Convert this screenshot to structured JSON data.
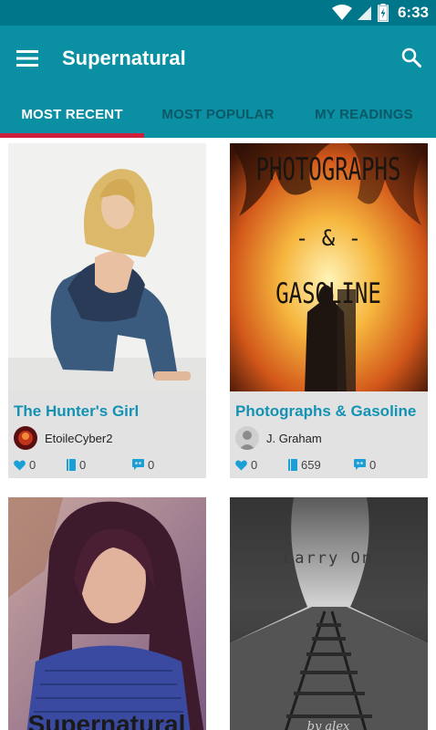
{
  "status_bar": {
    "time": "6:33"
  },
  "header": {
    "title": "Supernatural"
  },
  "tabs": [
    {
      "label": "MOST RECENT",
      "active": true
    },
    {
      "label": "MOST POPULAR",
      "active": false
    },
    {
      "label": "MY READINGS",
      "active": false
    }
  ],
  "colors": {
    "status_bar": "#00768a",
    "app_bar": "#0a8fa3",
    "tab_indicator": "#cc1f3b",
    "title_text": "#1392b4",
    "stat_icons": "#1a9fd6"
  },
  "stories": [
    {
      "title": "The Hunter's Girl",
      "author": "EtoileCyber2",
      "votes": "0",
      "reads": "0",
      "comments": "0"
    },
    {
      "title": "Photographs & Gasoline",
      "author": "J. Graham",
      "votes": "0",
      "reads": "659",
      "comments": "0",
      "cover_text": [
        "PHOTOGRAPHS",
        "- & -",
        "GASOLINE"
      ]
    },
    {
      "title": "",
      "author": "",
      "cover_text": [
        "Supernatural"
      ]
    },
    {
      "title": "",
      "author": "",
      "cover_text": [
        "Carry On",
        "by alex"
      ]
    }
  ]
}
